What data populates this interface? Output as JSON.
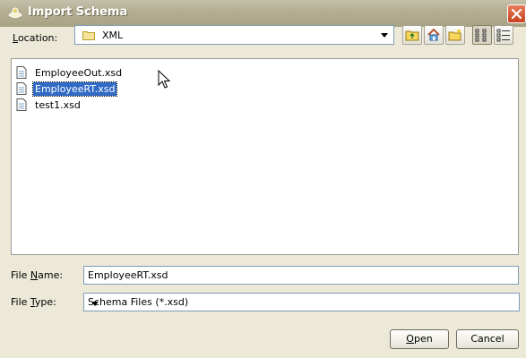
{
  "window": {
    "title": "Import Schema"
  },
  "location": {
    "label_prefix": "L",
    "label_rest": "ocation:",
    "value": "XML"
  },
  "files": [
    {
      "name": "EmployeeOut.xsd",
      "selected": false
    },
    {
      "name": "EmployeeRT.xsd",
      "selected": true
    },
    {
      "name": "test1.xsd",
      "selected": false
    }
  ],
  "file_name": {
    "label_pre": "File ",
    "label_u": "N",
    "label_post": "ame:",
    "value": "EmployeeRT.xsd"
  },
  "file_type": {
    "label_pre": "File ",
    "label_u": "T",
    "label_post": "ype:",
    "value": "Schema Files (*.xsd)"
  },
  "buttons": {
    "open": {
      "u": "O",
      "rest": "pen"
    },
    "cancel": "Cancel"
  },
  "colors": {
    "selection": "#316ac5",
    "titlebar": "#b4ae93",
    "dialog_bg": "#ece9d8"
  },
  "icons": [
    "schema-app-icon",
    "close-icon",
    "folder-icon",
    "up-folder-icon",
    "home-icon",
    "new-folder-icon",
    "list-view-icon",
    "details-view-icon",
    "file-icon",
    "mouse-cursor"
  ]
}
